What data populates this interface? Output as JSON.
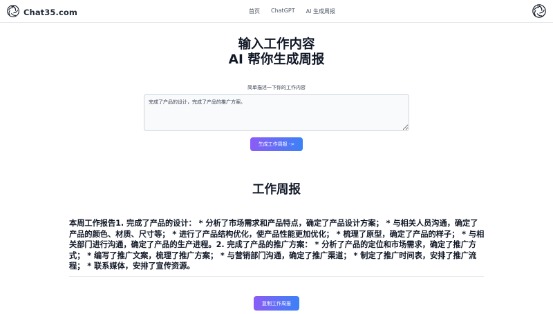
{
  "header": {
    "brand": "Chat35.com",
    "nav": [
      "首页",
      "ChatGPT",
      "AI 生成周报"
    ]
  },
  "hero": {
    "line1": "输入工作内容",
    "line2": "AI 帮你生成周报"
  },
  "form": {
    "label": "简单描述一下你的工作内容",
    "value": "完成了产品的设计，完成了产品的推广方案。",
    "generate_label": "生成工作周报 ->"
  },
  "report": {
    "title": "工作周报",
    "body": "本周工作报告1. 完成了产品的设计： * 分析了市场需求和产品特点，确定了产品设计方案； * 与相关人员沟通，确定了产品的颜色、材质、尺寸等； * 进行了产品结构优化，使产品性能更加优化； * 梳理了原型，确定了产品的样子； * 与相关部门进行沟通，确定了产品的生产进程。2. 完成了产品的推广方案： * 分析了产品的定位和市场需求，确定了推广方式； * 编写了推广文案，梳理了推广方案； * 与营销部门沟通，确定了推广渠道； * 制定了推广时间表，安排了推广流程； * 联系媒体，安排了宣传资源。",
    "copy_label": "复制工作周报"
  },
  "colors": {
    "button_gradient_start": "#8b5cf6",
    "button_gradient_end": "#3b82f6"
  },
  "icons": {
    "brand_logo": "openai-logo-icon"
  }
}
